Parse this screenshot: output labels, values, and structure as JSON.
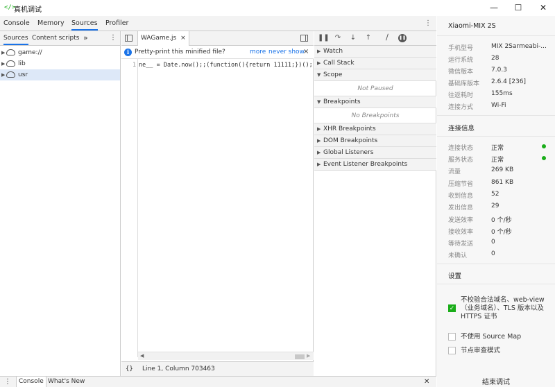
{
  "window": {
    "logo": "</>",
    "title": "真机调试",
    "minimize": "—",
    "maximize": "☐",
    "close": "✕"
  },
  "devtools_tabs": [
    "Console",
    "Memory",
    "Sources",
    "Profiler"
  ],
  "devtools_active_tab": "Sources",
  "navigator": {
    "tabs": [
      "Sources",
      "Content scripts"
    ],
    "more": "»",
    "menu": "⋮",
    "tree": [
      {
        "label": "game://"
      },
      {
        "label": "lib"
      },
      {
        "label": "usr"
      }
    ]
  },
  "editor": {
    "file_tab": "WAGame.js",
    "file_close": "×",
    "pretty_print_msg": "Pretty-print this minified file?",
    "more_link": "more",
    "never_show_link": "never show",
    "dismiss": "×",
    "line_number": "1",
    "code": "ne__ = Date.now();;(function(){return 11111;})();",
    "status_braces": "{}",
    "status_position": "Line 1, Column 703463"
  },
  "debugger": {
    "sections": {
      "watch": "Watch",
      "call_stack": "Call Stack",
      "scope": "Scope",
      "scope_body": "Not Paused",
      "breakpoints": "Breakpoints",
      "breakpoints_body": "No Breakpoints",
      "xhr": "XHR Breakpoints",
      "dom": "DOM Breakpoints",
      "global": "Global Listeners",
      "event": "Event Listener Breakpoints"
    }
  },
  "device": {
    "name": "Xiaomi-MIX 2S",
    "info": [
      {
        "key": "手机型号",
        "value": "MIX 2Sarmeabi-..."
      },
      {
        "key": "运行系统",
        "value": "28"
      },
      {
        "key": "微信版本",
        "value": "7.0.3"
      },
      {
        "key": "基础库版本",
        "value": "2.6.4 [236]"
      },
      {
        "key": "往返耗时",
        "value": "155ms"
      },
      {
        "key": "连接方式",
        "value": "Wi-Fi"
      }
    ],
    "conn_title": "连接信息",
    "conn": [
      {
        "key": "连接状态",
        "value": "正常"
      },
      {
        "key": "服务状态",
        "value": "正常"
      },
      {
        "key": "流量",
        "value": "269 KB"
      },
      {
        "key": "压缩节省",
        "value": "861 KB"
      },
      {
        "key": "收到信息",
        "value": "52"
      },
      {
        "key": "发出信息",
        "value": "29"
      },
      {
        "key": "发送效率",
        "value": "0 个/秒"
      },
      {
        "key": "接收效率",
        "value": "0 个/秒"
      },
      {
        "key": "等待发送",
        "value": "0"
      },
      {
        "key": "未确认",
        "value": "0"
      }
    ],
    "settings_title": "设置",
    "settings": [
      {
        "label": "不校验合法域名、web-view（业务域名）、TLS 版本以及 HTTPS 证书",
        "checked": true
      },
      {
        "label": "不使用 Source Map",
        "checked": false
      },
      {
        "label": "节点审查模式",
        "checked": false
      }
    ],
    "end_button": "结束调试"
  },
  "drawer": {
    "menu": "⋮",
    "tabs": [
      "Console",
      "What's New"
    ],
    "close": "✕"
  },
  "colors": {
    "accent": "#1a73e8",
    "status_ok": "#1aad19"
  }
}
